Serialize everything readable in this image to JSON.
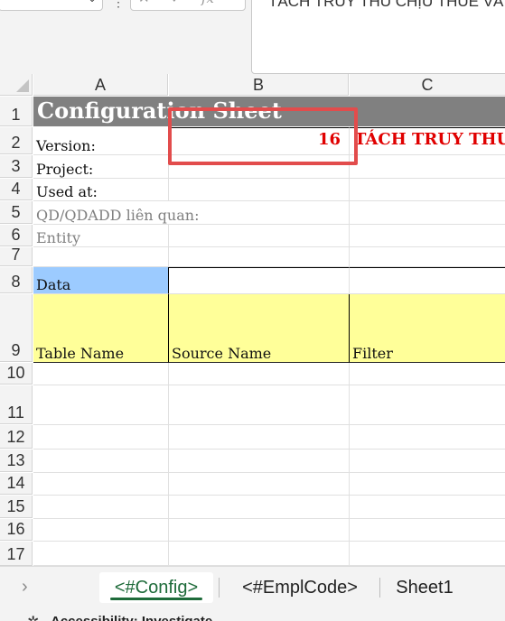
{
  "formula_bar": {
    "formula_text": "TÁCH TRUY THU CHỊU THUẾ VÀ",
    "fx_icons": [
      "cancel-icon",
      "enter-icon",
      "function-icon"
    ]
  },
  "columns": [
    "A",
    "B",
    "C"
  ],
  "rows": [
    "1",
    "2",
    "3",
    "4",
    "5",
    "6",
    "7",
    "8",
    "9",
    "10",
    "11",
    "12",
    "13",
    "14",
    "15",
    "16",
    "17"
  ],
  "sheet": {
    "title": "Configuration Sheet",
    "version_label": "Version:",
    "version_value": "16",
    "version_note": "TÁCH TRUY THU",
    "project_label": "Project:",
    "used_at_label": "Used at:",
    "qd_label": "QD/QDADD liên quan:",
    "entity_label": "Entity",
    "data_label": "Data",
    "headers": [
      "Table Name",
      "Source Name",
      "Filter"
    ]
  },
  "tabs": {
    "active": "<#Config>",
    "items": [
      "<#Config>",
      "<#EmplCode>",
      "Sheet1"
    ]
  },
  "status": {
    "text": "Accessibility: Investigate"
  },
  "colors": {
    "title_bg": "#808080",
    "data_bg": "#9ccbff",
    "header_bg": "#ffff99",
    "note_red": "#e00000",
    "active_tab": "#1e6b3a"
  }
}
